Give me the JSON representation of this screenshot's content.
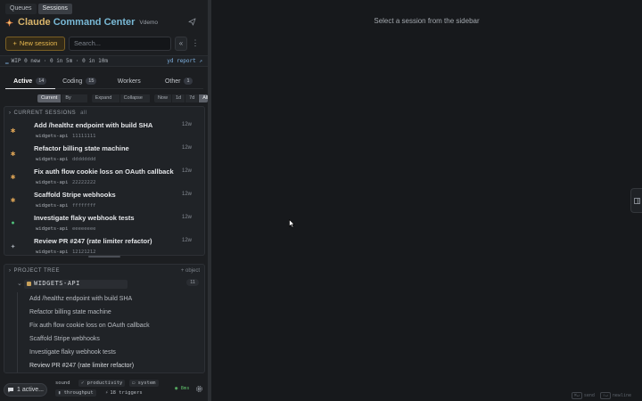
{
  "view_tabs": [
    {
      "label": "Queues",
      "active": false
    },
    {
      "label": "Sessions",
      "active": true
    }
  ],
  "app": {
    "title_prefix": "Claude ",
    "title_accent": "Command Center",
    "workspace": "Vdemo",
    "title_icon": "app-logo-icon",
    "send_icon": "send-icon"
  },
  "actions": {
    "new_session_label": "New session",
    "new_session_icon": "+",
    "search_placeholder": "Search...",
    "collapse_icon": "«",
    "menu_icon": "⋮"
  },
  "status": {
    "icon": "▁",
    "text": "WIP 0 new · 0 in 5m · 0 in 10m",
    "report_label": "yd report ↗"
  },
  "category_tabs": [
    {
      "label": "Active",
      "count": "14",
      "active": true
    },
    {
      "label": "Coding",
      "count": "15",
      "active": false
    },
    {
      "label": "Workers",
      "count": "",
      "active": false
    },
    {
      "label": "Other",
      "count": "1",
      "active": false
    }
  ],
  "filters": {
    "group_mode": [
      "Current",
      "By objects"
    ],
    "expand": [
      "Expand all",
      "Collapse all"
    ],
    "time": [
      "Now",
      "1d",
      "7d",
      "All"
    ]
  },
  "sessions_section": {
    "title": "CURRENT SESSIONS",
    "sub": "all",
    "items": [
      {
        "title": "Add /healthz endpoint with build SHA",
        "project": "widgets-api",
        "hash": "11111111",
        "time": "12w",
        "status_icon": "waiting-icon",
        "color": "#d9a154"
      },
      {
        "title": "Refactor billing state machine",
        "project": "widgets-api",
        "hash": "dddddddd",
        "time": "12w",
        "status_icon": "waiting-icon",
        "color": "#d9a154"
      },
      {
        "title": "Fix auth flow cookie loss on OAuth callback",
        "project": "widgets-api",
        "hash": "22222222",
        "time": "12w",
        "status_icon": "waiting-icon",
        "color": "#d9a154"
      },
      {
        "title": "Scaffold Stripe webhooks",
        "project": "widgets-api",
        "hash": "ffffffff",
        "time": "12w",
        "status_icon": "waiting-icon",
        "color": "#d9a154"
      },
      {
        "title": "Investigate flaky webhook tests",
        "project": "widgets-api",
        "hash": "eeeeeeee",
        "time": "12w",
        "status_icon": "running-icon",
        "color": "#4fbf7a"
      },
      {
        "title": "Review PR #247 (rate limiter refactor)",
        "project": "widgets-api",
        "hash": "12121212",
        "time": "12w",
        "status_icon": "sparkle-icon",
        "color": "#9aa0a8"
      }
    ]
  },
  "project_tree": {
    "title": "PROJECT TREE",
    "add_label": "+ object",
    "project": {
      "name": "WIDGETS-API",
      "count": "11",
      "chevron": "⌄"
    },
    "items": [
      "Add /healthz endpoint with build SHA",
      "Refactor billing state machine",
      "Fix auth flow cookie loss on OAuth callback",
      "Scaffold Stripe webhooks",
      "Investigate flaky webhook tests",
      "Review PR #247 (rate limiter refactor)"
    ]
  },
  "bottom": {
    "active_label": "1 active...",
    "sound_label": "sound",
    "productivity_label": "productivity",
    "system_label": "system",
    "throughput_label": "throughput",
    "triggers_label": "18 triggers",
    "latency": "8ms"
  },
  "main": {
    "empty_message": "Select a session from the sidebar",
    "hint_send_key": "⌘↵",
    "hint_send": "send",
    "hint_newline_key": "⇧↵",
    "hint_newline": "newline"
  },
  "colors": {
    "accent_amber": "#e8b94f",
    "accent_blue": "#79b9d6",
    "success": "#5fbf6a"
  }
}
